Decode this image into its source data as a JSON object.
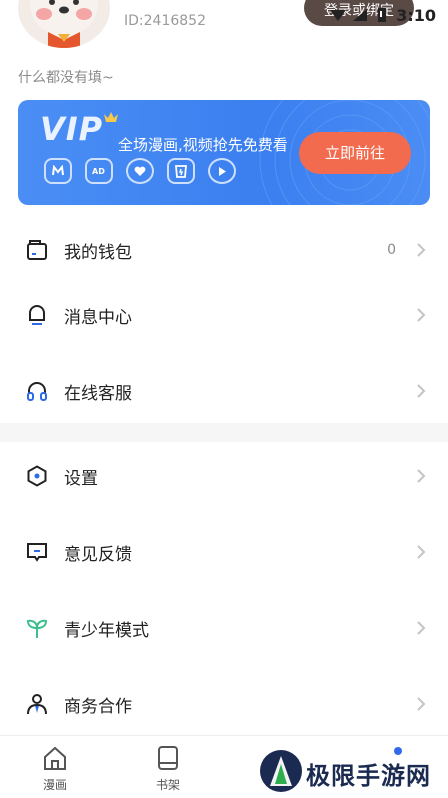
{
  "status_bar": {
    "time": "3:10"
  },
  "profile": {
    "user_id": "ID:2416852",
    "login_label": "登录或绑定",
    "bio": "什么都没有填~"
  },
  "vip": {
    "logo": "VIP",
    "slogan": "全场漫画,视频抢先免费看",
    "go_label": "立即前往",
    "perk_icons": [
      "mall-icon",
      "ad-free-icon",
      "heart-icon",
      "pocket-icon",
      "play-icon"
    ]
  },
  "menu": {
    "wallet": {
      "label": "我的钱包",
      "value": "0",
      "icon": "wallet-icon"
    },
    "messages": {
      "label": "消息中心",
      "icon": "bell-icon"
    },
    "support": {
      "label": "在线客服",
      "icon": "headset-icon"
    },
    "settings": {
      "label": "设置",
      "icon": "hexagon-gear-icon"
    },
    "feedback": {
      "label": "意见反馈",
      "icon": "feedback-icon"
    },
    "youth": {
      "label": "青少年模式",
      "icon": "sprout-icon"
    },
    "business": {
      "label": "商务合作",
      "icon": "person-tie-icon"
    }
  },
  "bottom_nav": {
    "home": {
      "label": "漫画",
      "icon": "home-icon"
    },
    "shelf": {
      "label": "书架",
      "icon": "bookshelf-icon"
    }
  },
  "watermark": {
    "text": "极限手游网"
  },
  "colors": {
    "vip_blue": "#3b7ff0",
    "go_button": "#f36b4f",
    "login_button": "#5a4a45",
    "sprout_green": "#3cbf8f",
    "accent_blue": "#2f6be8"
  }
}
